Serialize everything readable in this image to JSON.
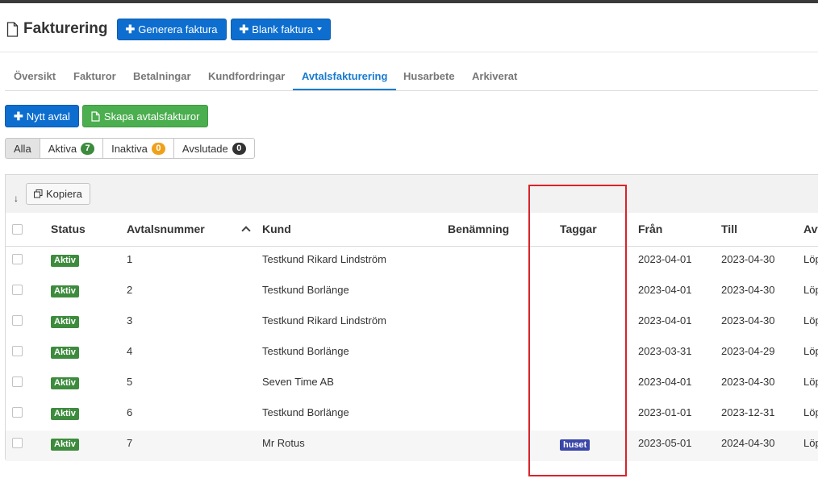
{
  "header": {
    "title": "Fakturering",
    "generate_label": "Generera faktura",
    "blank_label": "Blank faktura"
  },
  "tabs": [
    {
      "label": "Översikt"
    },
    {
      "label": "Fakturor"
    },
    {
      "label": "Betalningar"
    },
    {
      "label": "Kundfordringar"
    },
    {
      "label": "Avtalsfakturering",
      "active": true
    },
    {
      "label": "Husarbete"
    },
    {
      "label": "Arkiverat"
    }
  ],
  "actions": {
    "new_contract": "Nytt avtal",
    "create_invoices": "Skapa avtalsfakturor"
  },
  "filters": {
    "all": "Alla",
    "active": {
      "label": "Aktiva",
      "count": "7",
      "color": "#3d8b3d"
    },
    "inactive": {
      "label": "Inaktiva",
      "count": "0",
      "color": "#f0a11b"
    },
    "ended": {
      "label": "Avslutade",
      "count": "0",
      "color": "#333333"
    }
  },
  "toolbar": {
    "copy_label": "Kopiera"
  },
  "columns": {
    "status": "Status",
    "number": "Avtalsnummer",
    "customer": "Kund",
    "name": "Benämning",
    "tags": "Taggar",
    "from": "Från",
    "to": "Till",
    "cut": "Avt"
  },
  "rows": [
    {
      "status": "Aktiv",
      "number": "1",
      "customer": "Testkund Rikard Lindström",
      "tag": "",
      "from": "2023-04-01",
      "to": "2023-04-30",
      "cut": "Löp"
    },
    {
      "status": "Aktiv",
      "number": "2",
      "customer": "Testkund Borlänge",
      "tag": "",
      "from": "2023-04-01",
      "to": "2023-04-30",
      "cut": "Löp"
    },
    {
      "status": "Aktiv",
      "number": "3",
      "customer": "Testkund Rikard Lindström",
      "tag": "",
      "from": "2023-04-01",
      "to": "2023-04-30",
      "cut": "Löp"
    },
    {
      "status": "Aktiv",
      "number": "4",
      "customer": "Testkund Borlänge",
      "tag": "",
      "from": "2023-03-31",
      "to": "2023-04-29",
      "cut": "Löp"
    },
    {
      "status": "Aktiv",
      "number": "5",
      "customer": "Seven Time AB",
      "tag": "",
      "from": "2023-04-01",
      "to": "2023-04-30",
      "cut": "Löp"
    },
    {
      "status": "Aktiv",
      "number": "6",
      "customer": "Testkund Borlänge",
      "tag": "",
      "from": "2023-01-01",
      "to": "2023-12-31",
      "cut": "Löp"
    },
    {
      "status": "Aktiv",
      "number": "7",
      "customer": "Mr Rotus",
      "tag": "huset",
      "from": "2023-05-01",
      "to": "2024-04-30",
      "cut": "Löp"
    }
  ],
  "colors": {
    "primary": "#0d6ecf",
    "success": "#4bae4f",
    "active_tab": "#1a7bd0",
    "status_active": "#3d8b3d",
    "tag": "#3b47a8",
    "highlight": "#d9232a"
  }
}
